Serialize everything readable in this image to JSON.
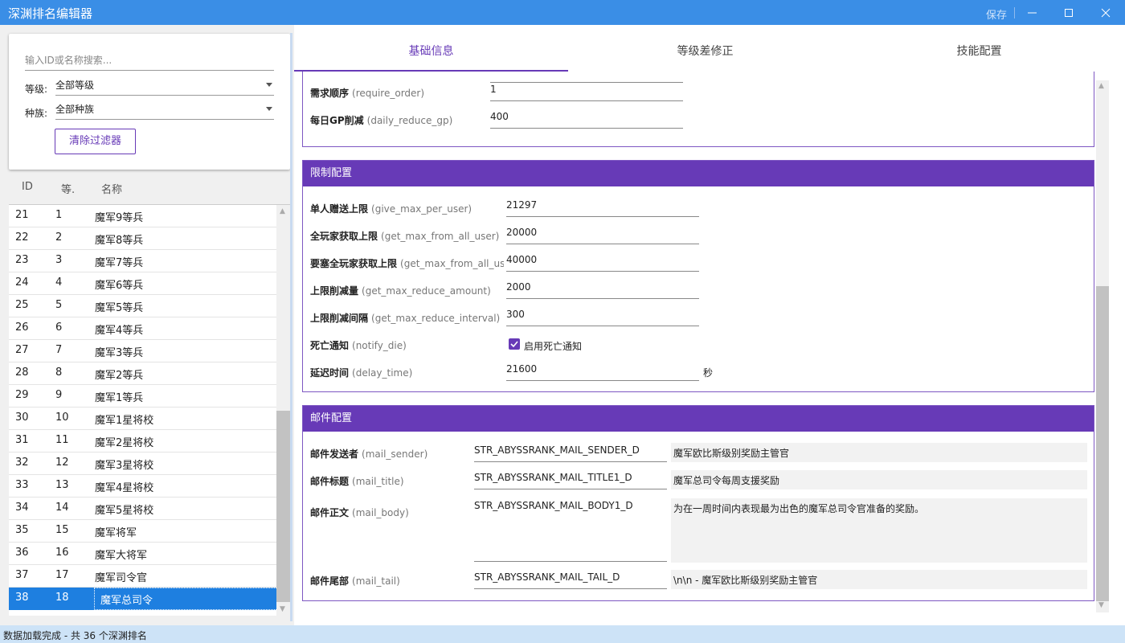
{
  "app": {
    "title": "深渊排名编辑器",
    "save_label": "保存"
  },
  "filters": {
    "search_placeholder": "输入ID或名称搜索...",
    "level_label": "等级:",
    "level_value": "全部等级",
    "race_label": "种族:",
    "race_value": "全部种族",
    "clear_label": "清除过滤器"
  },
  "list": {
    "headers": [
      "ID",
      "等.",
      "名称"
    ],
    "rows": [
      {
        "id": "21",
        "level": "1",
        "name": "魔军9等兵"
      },
      {
        "id": "22",
        "level": "2",
        "name": "魔军8等兵"
      },
      {
        "id": "23",
        "level": "3",
        "name": "魔军7等兵"
      },
      {
        "id": "24",
        "level": "4",
        "name": "魔军6等兵"
      },
      {
        "id": "25",
        "level": "5",
        "name": "魔军5等兵"
      },
      {
        "id": "26",
        "level": "6",
        "name": "魔军4等兵"
      },
      {
        "id": "27",
        "level": "7",
        "name": "魔军3等兵"
      },
      {
        "id": "28",
        "level": "8",
        "name": "魔军2等兵"
      },
      {
        "id": "29",
        "level": "9",
        "name": "魔军1等兵"
      },
      {
        "id": "30",
        "level": "10",
        "name": "魔军1星将校"
      },
      {
        "id": "31",
        "level": "11",
        "name": "魔军2星将校"
      },
      {
        "id": "32",
        "level": "12",
        "name": "魔军3星将校"
      },
      {
        "id": "33",
        "level": "13",
        "name": "魔军4星将校"
      },
      {
        "id": "34",
        "level": "14",
        "name": "魔军5星将校"
      },
      {
        "id": "35",
        "level": "15",
        "name": "魔军将军"
      },
      {
        "id": "36",
        "level": "16",
        "name": "魔军大将军"
      },
      {
        "id": "37",
        "level": "17",
        "name": "魔军司令官"
      },
      {
        "id": "38",
        "level": "18",
        "name": "魔军总司令"
      }
    ],
    "selected_id": "38"
  },
  "tabs": [
    "基础信息",
    "等级差修正",
    "技能配置"
  ],
  "basic": {
    "require_order": {
      "label": "需求顺序",
      "key": "(require_order)",
      "value": "1"
    },
    "daily_reduce_gp": {
      "label": "每日GP削减",
      "key": "(daily_reduce_gp)",
      "value": "400"
    }
  },
  "limits": {
    "title": "限制配置",
    "give_max_per_user": {
      "label": "单人赠送上限",
      "key": "(give_max_per_user)",
      "value": "21297"
    },
    "get_max_from_all_user": {
      "label": "全玩家获取上限",
      "key": "(get_max_from_all_user)",
      "value": "20000"
    },
    "get_max_from_all_user_fortress": {
      "label": "要塞全玩家获取上限",
      "key": "(get_max_from_all_use",
      "value": "40000"
    },
    "get_max_reduce_amount": {
      "label": "上限削减量",
      "key": "(get_max_reduce_amount)",
      "value": "2000"
    },
    "get_max_reduce_interval": {
      "label": "上限削减间隔",
      "key": "(get_max_reduce_interval)",
      "value": "300"
    },
    "notify_die": {
      "label": "死亡通知",
      "key": "(notify_die)",
      "checkbox_label": "启用死亡通知",
      "checked": true
    },
    "delay_time": {
      "label": "延迟时间",
      "key": "(delay_time)",
      "value": "21600",
      "unit": "秒"
    }
  },
  "mail": {
    "title": "邮件配置",
    "sender": {
      "label": "邮件发送者",
      "key": "(mail_sender)",
      "value": "STR_ABYSSRANK_MAIL_SENDER_D",
      "preview": "魔军欧比斯级别奖励主管官"
    },
    "title_field": {
      "label": "邮件标题",
      "key": "(mail_title)",
      "value": "STR_ABYSSRANK_MAIL_TITLE1_D",
      "preview": "魔军总司令每周支援奖励"
    },
    "body": {
      "label": "邮件正文",
      "key": "(mail_body)",
      "value": "STR_ABYSSRANK_MAIL_BODY1_D",
      "preview": "为在一周时间内表现最为出色的魔军总司令官准备的奖励。"
    },
    "tail": {
      "label": "邮件尾部",
      "key": "(mail_tail)",
      "value": "STR_ABYSSRANK_MAIL_TAIL_D",
      "preview": "\\n\\n - 魔军欧比斯级别奖励主管官"
    }
  },
  "status": "数据加载完成 - 共 36 个深渊排名",
  "colors": {
    "accent": "#673ab7",
    "titlebar": "#3a8ee6",
    "selection": "#1e7fe0"
  }
}
